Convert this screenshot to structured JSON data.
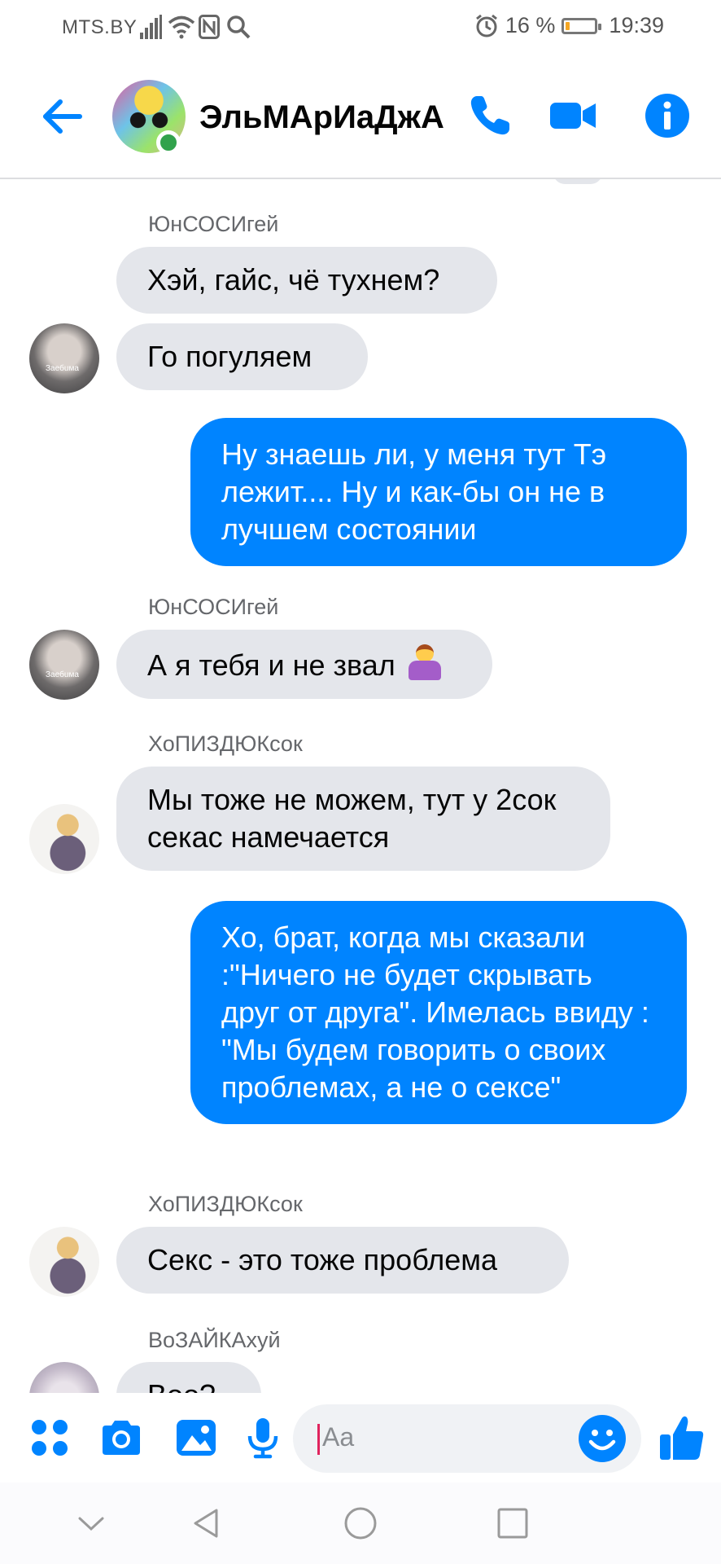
{
  "status_bar": {
    "carrier": "MTS.BY",
    "battery_percent": "16 %",
    "battery_level": 0.16,
    "time": "19:39"
  },
  "header": {
    "contact_name": "ЭльМАрИаДжА",
    "online": true,
    "accent_color": "#0084ff"
  },
  "messages": [
    {
      "type": "sender",
      "text": "ЮнСОСИгей"
    },
    {
      "type": "in",
      "text": "Хэй, гайс, чё тухнем?"
    },
    {
      "type": "in",
      "text": "Го погуляем"
    },
    {
      "type": "out",
      "text": "Ну знаешь ли, у меня тут Тэ лежит.... Ну и как-бы он не в лучшем состоянии"
    },
    {
      "type": "sender",
      "text": "ЮнСОСИгей"
    },
    {
      "type": "in",
      "text": "А я тебя и не звал",
      "emoji": "person-shrugging"
    },
    {
      "type": "sender",
      "text": "ХоПИЗДЮКсок"
    },
    {
      "type": "in",
      "text": "Мы тоже не можем, тут у 2сок секас намечается"
    },
    {
      "type": "out",
      "text": "Хо, брат, когда мы сказали :\"Ничего не будет скрывать друг от друга\". Имелась ввиду : \"Мы будем говорить о своих проблемах, а не о сексе\""
    },
    {
      "type": "sender",
      "text": "ХоПИЗДЮКсок"
    },
    {
      "type": "in",
      "text": "Секс - это тоже проблема"
    },
    {
      "type": "sender",
      "text": "ВоЗАЙКАхуй"
    },
    {
      "type": "in",
      "text": "Воо?"
    }
  ],
  "avatar_caption": "Зaeбuмa",
  "composer": {
    "placeholder": "Aa",
    "icons": [
      "apps-icon",
      "camera-icon",
      "gallery-icon",
      "microphone-icon",
      "emoji-icon",
      "like-icon"
    ]
  },
  "navbar": {
    "icons": [
      "collapse-icon",
      "back-icon",
      "home-icon",
      "recents-icon"
    ]
  }
}
